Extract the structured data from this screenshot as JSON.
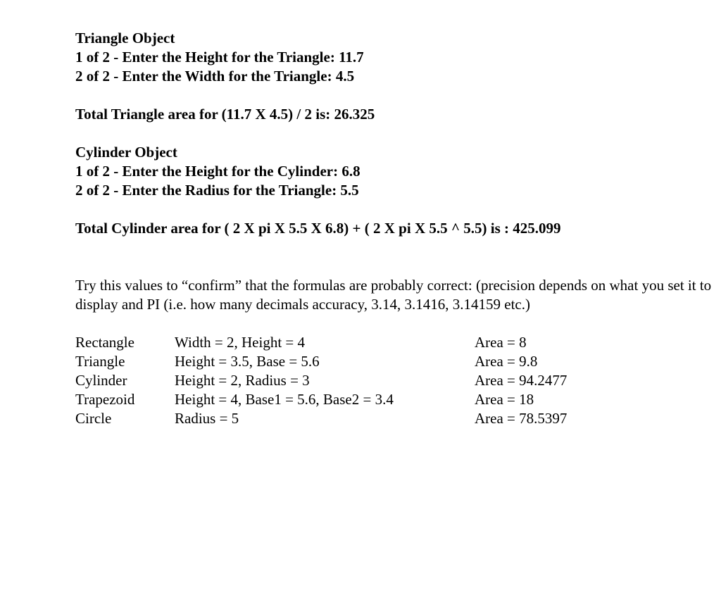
{
  "triangle_section": {
    "title": "Triangle Object",
    "prompt_height": "1 of 2 - Enter the Height for the Triangle: 11.7",
    "prompt_width": "2 of 2 - Enter the Width for the Triangle: 4.5",
    "total": "Total Triangle area for (11.7 X 4.5) / 2 is: 26.325"
  },
  "cylinder_section": {
    "title": "Cylinder Object",
    "prompt_height": "1 of 2 - Enter the Height for the Cylinder: 6.8",
    "prompt_radius": "2 of 2 - Enter the Radius for the Triangle: 5.5",
    "total": "Total Cylinder area for ( 2 X pi X 5.5 X 6.8) + ( 2 X pi X 5.5 ^ 5.5) is : 425.099"
  },
  "note": {
    "text": "Try this values to “confirm” that the formulas are probably correct: (precision depends on what you set it to display and PI (i.e. how many decimals accuracy, 3.14, 3.1416, 3.14159 etc.)"
  },
  "test_values": [
    {
      "shape": "Rectangle",
      "params": "Width = 2, Height = 4",
      "area": "Area = 8"
    },
    {
      "shape": "Triangle",
      "params": "Height = 3.5, Base = 5.6",
      "area": "Area = 9.8"
    },
    {
      "shape": "Cylinder",
      "params": "Height = 2, Radius = 3",
      "area": "Area = 94.2477"
    },
    {
      "shape": "Trapezoid",
      "params": "Height = 4, Base1 = 5.6, Base2 = 3.4",
      "area": "Area = 18"
    },
    {
      "shape": "Circle",
      "params": "Radius = 5",
      "area": "Area = 78.5397"
    }
  ]
}
